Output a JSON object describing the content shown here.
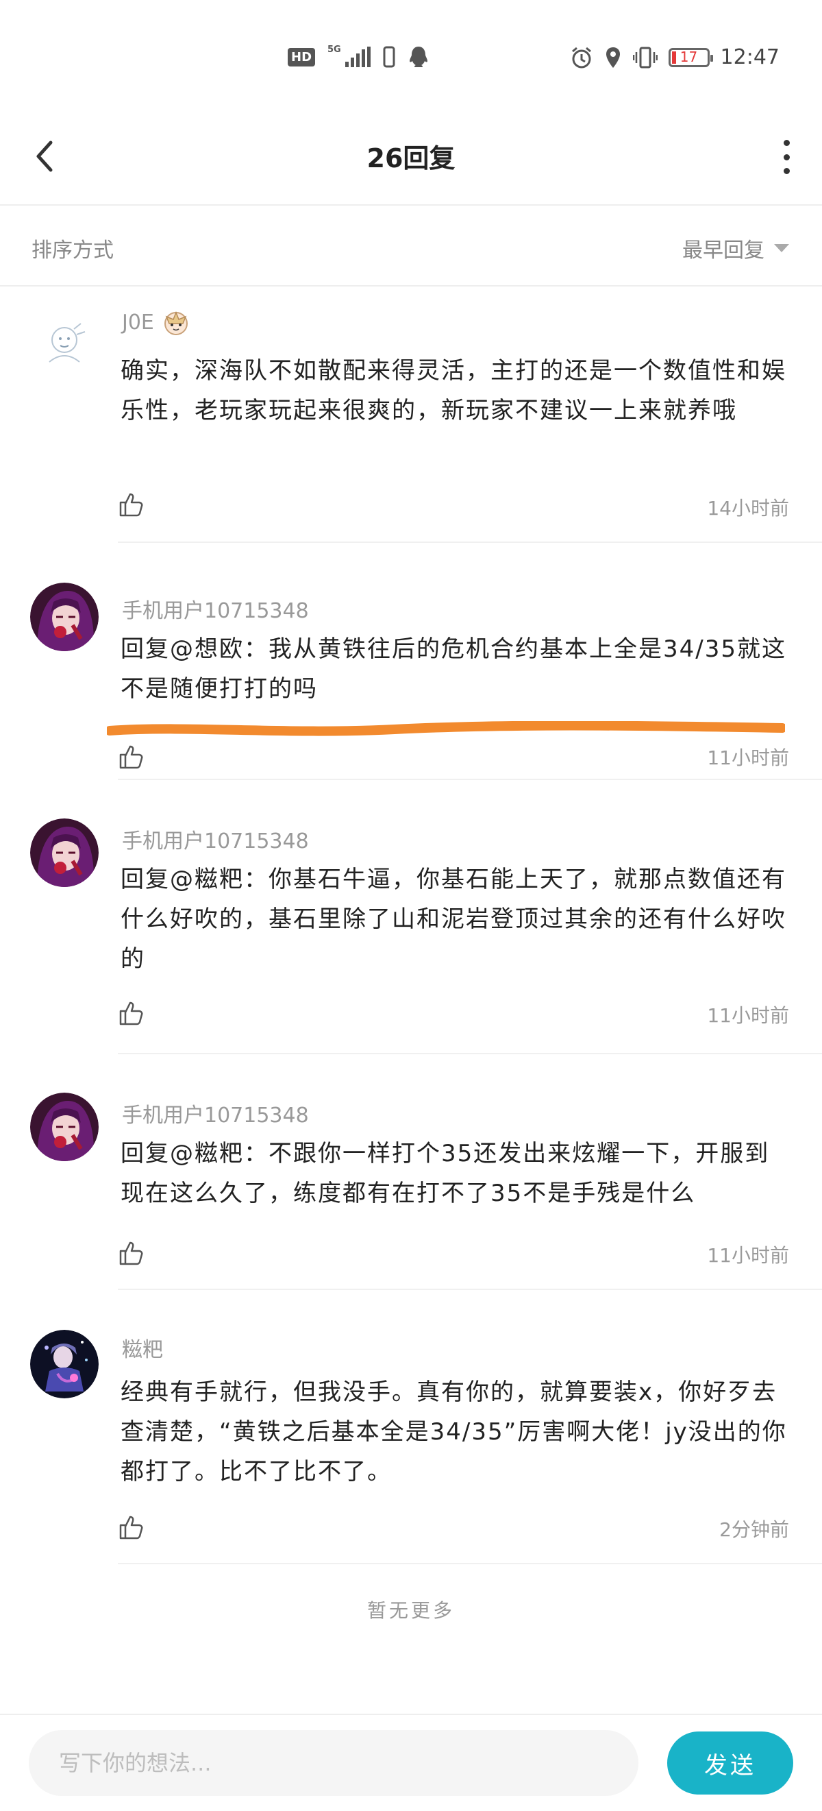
{
  "status_bar": {
    "hd": "HD",
    "network": "5G",
    "battery": "17",
    "time": "12:47"
  },
  "header": {
    "title": "26回复"
  },
  "sort": {
    "label": "排序方式",
    "value": "最早回复"
  },
  "comments": [
    {
      "user": "J0E",
      "content": "确实，深海队不如散配来得灵活，主打的还是一个数值性和娱乐性，老玩家玩起来很爽的，新玩家不建议一上来就养哦",
      "time": "14小时前"
    },
    {
      "user": "手机用户10715348",
      "content": "回复@想欧：我从黄铁往后的危机合约基本上全是34/35就这不是随便打打的吗",
      "time": "11小时前"
    },
    {
      "user": "手机用户10715348",
      "content": "回复@糍粑：你基石牛逼，你基石能上天了，就那点数值还有什么好吹的，基石里除了山和泥岩登顶过其余的还有什么好吹的",
      "time": "11小时前"
    },
    {
      "user": "手机用户10715348",
      "content": "回复@糍粑：不跟你一样打个35还发出来炫耀一下，开服到现在这么久了，练度都有在打不了35不是手残是什么",
      "time": "11小时前"
    },
    {
      "user": "糍粑",
      "content": "经典有手就行，但我没手。真有你的，就算要装x，你好歹去查清楚，“黄铁之后基本全是34/35”厉害啊大佬！jy没出的你都打了。比不了比不了。",
      "time": "2分钟前"
    }
  ],
  "no_more": "暂无更多",
  "input": {
    "placeholder": "写下你的想法..."
  },
  "send_label": "发送",
  "colors": {
    "accent": "#19b3c8",
    "highlight_stroke": "#f28a2e"
  }
}
